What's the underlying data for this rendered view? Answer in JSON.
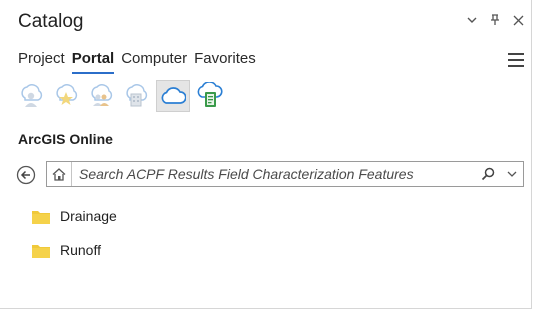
{
  "pane": {
    "title": "Catalog",
    "controls": [
      "options-dropdown-icon",
      "pin-icon",
      "close-icon"
    ]
  },
  "tabs": [
    {
      "label": "Project",
      "active": false
    },
    {
      "label": "Portal",
      "active": true
    },
    {
      "label": "Computer",
      "active": false
    },
    {
      "label": "Favorites",
      "active": false
    }
  ],
  "portal_icons": [
    {
      "name": "my-content-icon",
      "selected": false
    },
    {
      "name": "my-favorites-icon",
      "selected": false
    },
    {
      "name": "my-groups-icon",
      "selected": false
    },
    {
      "name": "my-organization-icon",
      "selected": false
    },
    {
      "name": "arcgis-online-icon",
      "selected": true
    },
    {
      "name": "living-atlas-icon",
      "selected": false
    }
  ],
  "section": {
    "label": "ArcGIS Online"
  },
  "search": {
    "placeholder": "Search ACPF Results Field Characterization Features"
  },
  "items": [
    {
      "label": "Drainage",
      "icon": "folder-icon"
    },
    {
      "label": "Runoff",
      "icon": "folder-icon"
    }
  ],
  "colors": {
    "accent": "#2b6ec9",
    "folder": "#f0c93a",
    "muted_icon": "#a9c7e8"
  }
}
